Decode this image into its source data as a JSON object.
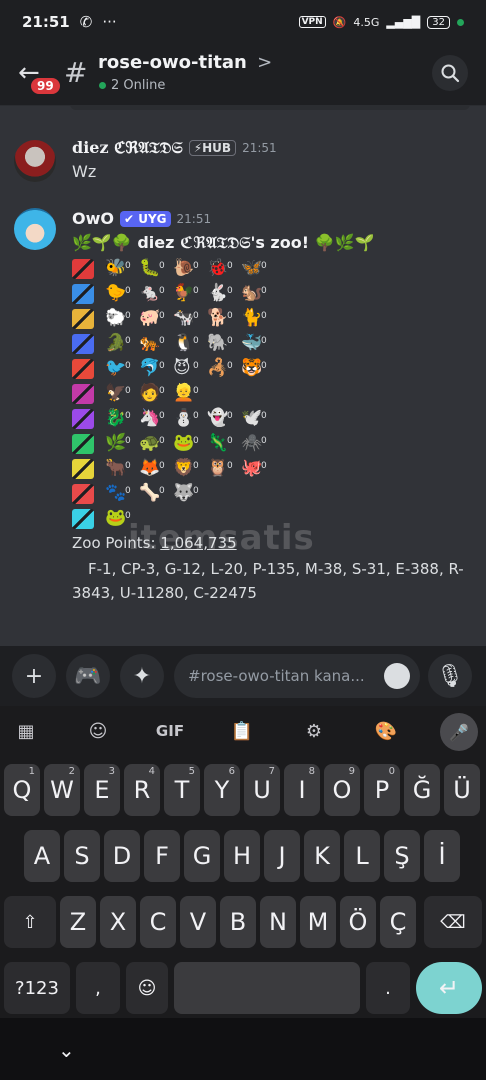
{
  "status_bar": {
    "time": "21:51",
    "vpn": "VPN",
    "network": "4.5G",
    "battery": "32"
  },
  "header": {
    "back_badge": "99",
    "channel_name": "rose-owo-titan",
    "chevron": ">",
    "online_text": "2 Online"
  },
  "messages": [
    {
      "author": "diez ℭℜ𝔄𝔗𝔇𝔖",
      "tag": "HUB",
      "time": "21:51",
      "text": "Wz"
    },
    {
      "author": "OwO",
      "tag": "UYG",
      "time": "21:51",
      "zoo_title": "🌿🌱🌳 diez ℭℜ𝔄𝔗𝔇𝔖's zoo! 🌳🌿🌱",
      "zoo_points_label": "Zoo Points: ",
      "zoo_points_value": "1,064,735",
      "counts_line": "F-1, CP-3, G-12, L-20, P-135, M-38, S-31, E-388, R-3843, U-11280, C-22475"
    }
  ],
  "zoo_rows": [
    {
      "color": "#e03b3b",
      "animals": [
        "🐝",
        "🐛",
        "🐌",
        "🐞",
        "🦋"
      ]
    },
    {
      "color": "#3a8ee6",
      "animals": [
        "🐤",
        "🐁",
        "🐓",
        "🐇",
        "🐿️"
      ]
    },
    {
      "color": "#e8b33a",
      "animals": [
        "🐑",
        "🐖",
        "🐄",
        "🐕",
        "🐈"
      ]
    },
    {
      "color": "#4a6cf0",
      "animals": [
        "🐊",
        "🐅",
        "🐧",
        "🐘",
        "🐳"
      ]
    },
    {
      "color": "#e8493a",
      "animals": [
        "🐦",
        "🐬",
        "😈",
        "🦂",
        "🐯"
      ]
    },
    {
      "color": "#c33aa8",
      "animals": [
        "🦅",
        "🧑",
        "👱",
        "",
        ""
      ]
    },
    {
      "color": "#9b4ae8",
      "animals": [
        "🐉",
        "🦄",
        "⛄",
        "👻",
        "🕊️"
      ]
    },
    {
      "color": "#2fc46a",
      "animals": [
        "🌿",
        "🐢",
        "🐸",
        "🦎",
        "🕷️"
      ]
    },
    {
      "color": "#e6d43a",
      "animals": [
        "🐂",
        "🦊",
        "🦁",
        "🦉",
        "🐙"
      ]
    },
    {
      "color": "#e84a4a",
      "animals": [
        "🐾",
        "🦴",
        "🐺",
        "",
        ""
      ]
    },
    {
      "color": "#3ad1e6",
      "animals": [
        "🐸",
        "",
        "",
        "",
        ""
      ]
    }
  ],
  "watermark": "itemsatis",
  "composer": {
    "placeholder": "#rose-owo-titan kana..."
  },
  "keyboard": {
    "toolbar": [
      "GIF"
    ],
    "row1": [
      {
        "k": "Q",
        "h": "1"
      },
      {
        "k": "W",
        "h": "2"
      },
      {
        "k": "E",
        "h": "3"
      },
      {
        "k": "R",
        "h": "4"
      },
      {
        "k": "T",
        "h": "5"
      },
      {
        "k": "Y",
        "h": "6"
      },
      {
        "k": "U",
        "h": "7"
      },
      {
        "k": "I",
        "h": "8"
      },
      {
        "k": "O",
        "h": "9"
      },
      {
        "k": "P",
        "h": "0"
      },
      {
        "k": "Ğ",
        "h": ""
      },
      {
        "k": "Ü",
        "h": ""
      }
    ],
    "row2": [
      "A",
      "S",
      "D",
      "F",
      "G",
      "H",
      "J",
      "K",
      "L",
      "Ş",
      "İ"
    ],
    "row3": [
      "Z",
      "X",
      "C",
      "V",
      "B",
      "N",
      "M",
      "Ö",
      "Ç"
    ],
    "symbols": "?123",
    "comma": ",",
    "period": "."
  }
}
